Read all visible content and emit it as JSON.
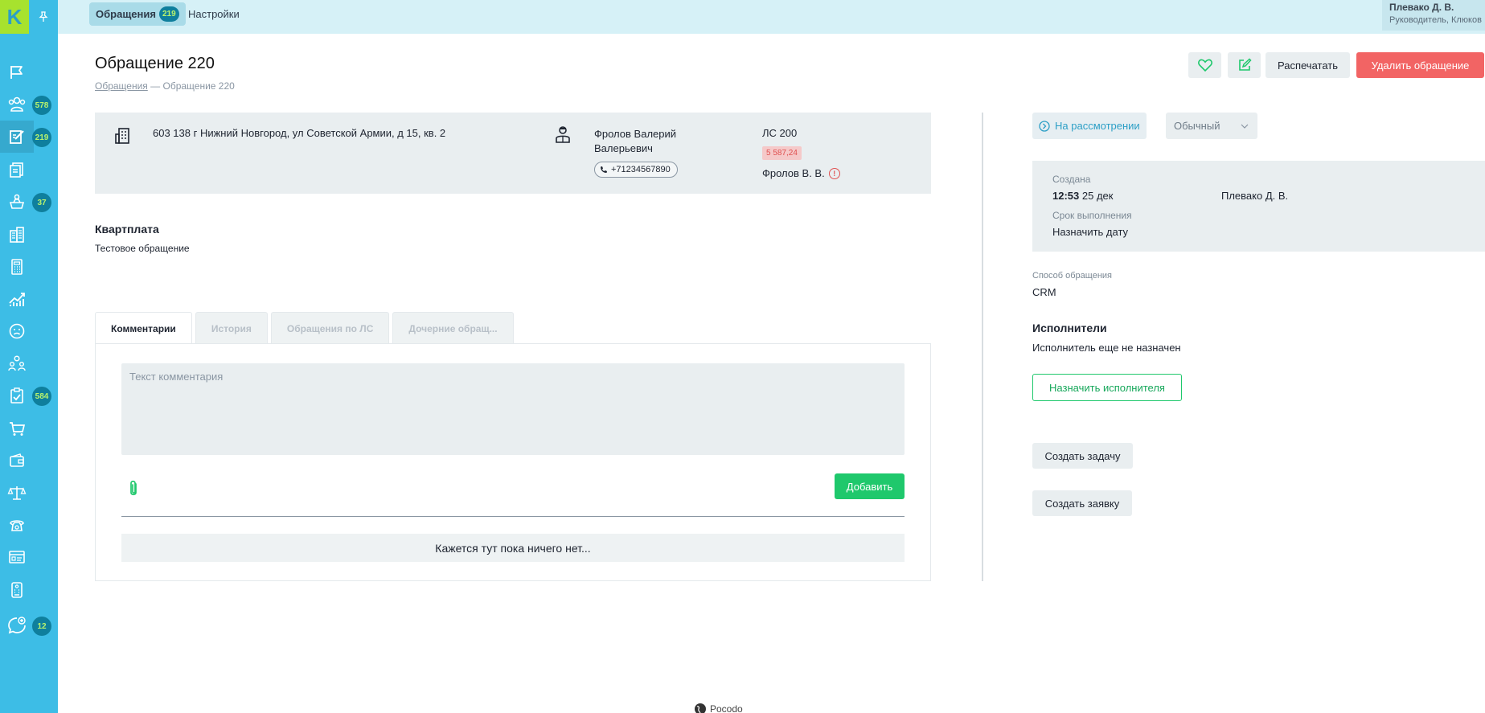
{
  "sidebar": {
    "logo": "K",
    "badges": [
      "578",
      "219",
      "37",
      "584",
      "12"
    ]
  },
  "topbar": {
    "tabs": [
      {
        "label": "Обращения",
        "count": "219"
      },
      {
        "label": "Настройки"
      }
    ],
    "user": {
      "name": "Плевако Д. В.",
      "role": "Руководитель, Клюков"
    }
  },
  "header": {
    "title": "Обращение 220",
    "breadcrumb": {
      "link": "Обращения",
      "sep": "—",
      "current": "Обращение 220"
    },
    "print_label": "Распечатать",
    "delete_label": "Удалить обращение"
  },
  "info": {
    "address": "603 138 г Нижний Новгород, ул Советской Армии, д 15, кв. 2",
    "person_name": "Фролов Валерий Валерьевич",
    "phone": "+71234567890",
    "account": "ЛС 200",
    "debt": "5 587,24",
    "owner": "Фролов В. В."
  },
  "subject": {
    "title": "Квартплата",
    "description": "Тестовое обращение"
  },
  "tabs": [
    "Комментарии",
    "История",
    "Обращения по ЛС",
    "Дочерние обращ..."
  ],
  "comments": {
    "placeholder": "Текст комментария",
    "add_label": "Добавить",
    "empty_text": "Кажется тут пока ничего нет..."
  },
  "right": {
    "status": "На рассмотрении",
    "priority": "Обычный",
    "created_label": "Создана",
    "created_time": "12:53",
    "created_date": "25 дек",
    "created_by": "Плевако Д. В.",
    "deadline_label": "Срок выполнения",
    "deadline_value": "Назначить дату",
    "method_label": "Способ обращения",
    "method_value": "CRM",
    "executors_title": "Исполнители",
    "executors_status": "Исполнитель еще не назначен",
    "assign_label": "Назначить исполнителя",
    "create_task_label": "Создать задачу",
    "create_request_label": "Создать заявку"
  },
  "footer": {
    "text": "Pocodo"
  },
  "colors": {
    "sidebar": "#3dbde6",
    "accent_green": "#1fc86c",
    "danger": "#f26464",
    "status_blue": "#2c9fc6"
  }
}
